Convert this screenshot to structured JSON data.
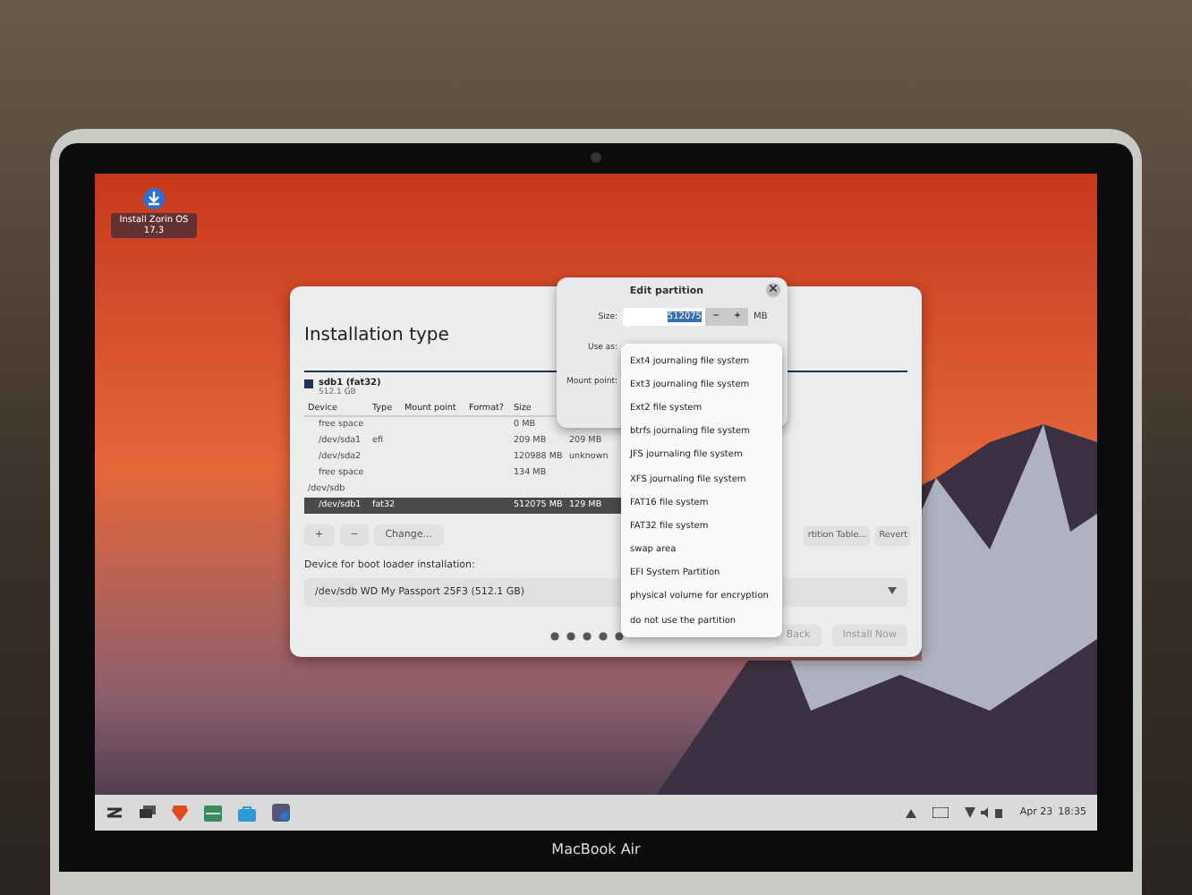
{
  "desktop_icon": {
    "label": "Install Zorin OS 17.3"
  },
  "installer": {
    "title": "Installation type",
    "legend": {
      "name": "sdb1 (fat32)",
      "size": "512.1 GB"
    },
    "columns": [
      "Device",
      "Type",
      "Mount point",
      "Format?",
      "Size"
    ],
    "rows": [
      {
        "kind": "partition",
        "cells": [
          "free space",
          "",
          "",
          "",
          "0 MB",
          ""
        ],
        "selected": false
      },
      {
        "kind": "partition",
        "cells": [
          "/dev/sda1",
          "efi",
          "",
          "",
          "209 MB",
          "209 MB"
        ],
        "selected": false
      },
      {
        "kind": "partition",
        "cells": [
          "/dev/sda2",
          "",
          "",
          "",
          "120988 MB",
          "unknown"
        ],
        "selected": false
      },
      {
        "kind": "partition",
        "cells": [
          "free space",
          "",
          "",
          "",
          "134 MB",
          ""
        ],
        "selected": false
      },
      {
        "kind": "disk",
        "cells": [
          "/dev/sdb",
          "",
          "",
          "",
          "",
          ""
        ],
        "selected": false
      },
      {
        "kind": "partition",
        "cells": [
          "/dev/sdb1",
          "fat32",
          "",
          "",
          "512075 MB",
          "129 MB"
        ],
        "selected": true
      }
    ],
    "tools": [
      "+",
      "−",
      "Change..."
    ],
    "table_buttons": [
      "rtition Table...",
      "Revert"
    ],
    "boot_label": "Device for boot loader installation:",
    "boot_device": "/dev/sdb  WD My Passport 25F3 (512.1 GB)",
    "buttons": [
      {
        "label": "Back",
        "disabled": true
      },
      {
        "label": "Install Now",
        "disabled": true
      }
    ]
  },
  "edit_dialog": {
    "title": "Edit partition",
    "size_label": "Size:",
    "size_value": "512075",
    "unit": "MB",
    "use_as_label": "Use as:",
    "mount_label": "Mount point:",
    "minus": "−",
    "plus": "+"
  },
  "use_as_options": [
    {
      "label": "Ext4 journaling file system",
      "selected": false
    },
    {
      "label": "Ext3 journaling file system",
      "selected": false
    },
    {
      "label": "Ext2 file system",
      "selected": false
    },
    {
      "label": "btrfs journaling file system",
      "selected": false
    },
    {
      "label": "JFS journaling file system",
      "selected": false
    },
    {
      "label": "XFS journaling file system",
      "selected": false
    },
    {
      "label": "FAT16 file system",
      "selected": false
    },
    {
      "label": "FAT32 file system",
      "selected": false
    },
    {
      "label": "swap area",
      "selected": false
    },
    {
      "label": "EFI System Partition",
      "selected": false
    },
    {
      "label": "physical volume for encryption",
      "selected": false
    },
    {
      "label": "do not use the partition",
      "selected": false
    }
  ],
  "taskbar": {
    "date": "Apr 23",
    "time": "18:35"
  },
  "laptop": {
    "brand": "MacBook Air"
  }
}
